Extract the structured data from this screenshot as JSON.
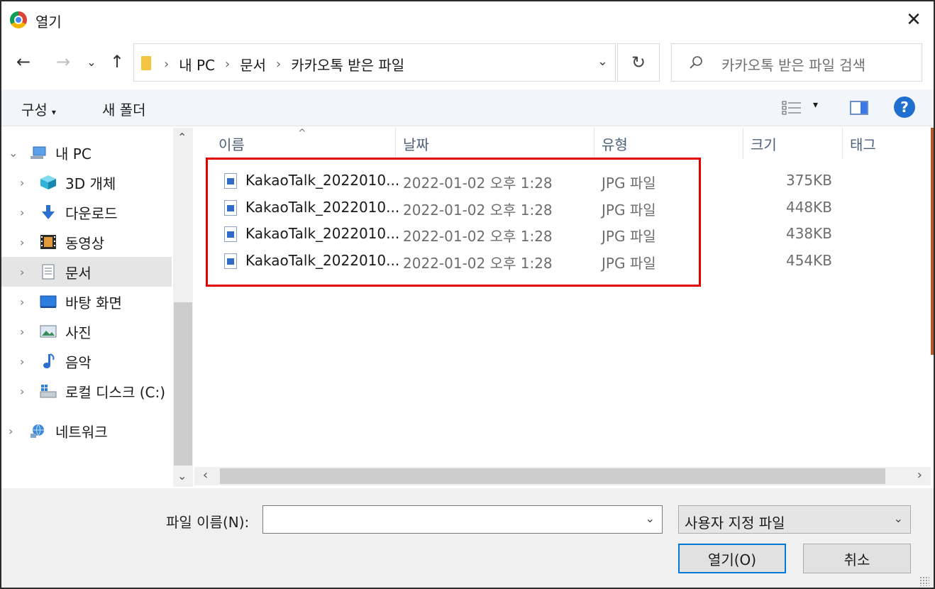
{
  "window": {
    "title": "열기",
    "close_glyph": "✕"
  },
  "nav": {
    "back_glyph": "←",
    "forward_glyph": "→",
    "recent_glyph": "⌄",
    "up_glyph": "↑",
    "breadcrumbs": [
      "내 PC",
      "문서",
      "카카오톡 받은 파일"
    ],
    "crumb_separator": "›",
    "address_dropdown_glyph": "⌄",
    "refresh_glyph": "↻",
    "search_placeholder": "카카오톡 받은 파일 검색"
  },
  "toolbar": {
    "organize_label": "구성",
    "organize_caret": "▾",
    "new_folder_label": "새 폴더",
    "view_caret": "▾",
    "help_glyph": "?"
  },
  "sidebar": {
    "items": [
      {
        "label": "내 PC",
        "expander": "⌄",
        "icon": "computer-icon"
      },
      {
        "label": "3D 개체",
        "expander": "›",
        "icon": "cube-3d-icon"
      },
      {
        "label": "다운로드",
        "expander": "›",
        "icon": "download-arrow-icon"
      },
      {
        "label": "동영상",
        "expander": "›",
        "icon": "film-icon"
      },
      {
        "label": "문서",
        "expander": "›",
        "icon": "document-icon"
      },
      {
        "label": "바탕 화면",
        "expander": "›",
        "icon": "desktop-icon"
      },
      {
        "label": "사진",
        "expander": "›",
        "icon": "picture-icon"
      },
      {
        "label": "음악",
        "expander": "›",
        "icon": "music-note-icon"
      },
      {
        "label": "로컬 디스크 (C:)",
        "expander": "›",
        "icon": "drive-icon"
      },
      {
        "label": "네트워크",
        "expander": "›",
        "icon": "network-icon"
      }
    ],
    "selected": "문서",
    "scroll_up_glyph": "⌃",
    "scroll_down_glyph": "⌄"
  },
  "filelist": {
    "columns": {
      "name": "이름",
      "date": "날짜",
      "type": "유형",
      "size": "크기",
      "tags": "태그"
    },
    "sort_glyph": "^",
    "files": [
      {
        "name": "KakaoTalk_2022010...",
        "date": "2022-01-02 오후 1:28",
        "type": "JPG 파일",
        "size": "375KB"
      },
      {
        "name": "KakaoTalk_2022010...",
        "date": "2022-01-02 오후 1:28",
        "type": "JPG 파일",
        "size": "448KB"
      },
      {
        "name": "KakaoTalk_2022010...",
        "date": "2022-01-02 오후 1:28",
        "type": "JPG 파일",
        "size": "438KB"
      },
      {
        "name": "KakaoTalk_2022010...",
        "date": "2022-01-02 오후 1:28",
        "type": "JPG 파일",
        "size": "454KB"
      }
    ],
    "scroll_left_glyph": "‹",
    "scroll_right_glyph": "›"
  },
  "bottom": {
    "filename_label": "파일 이름(N):",
    "filename_value": "",
    "filename_dropdown_glyph": "⌄",
    "filetype_value": "사용자 지정 파일",
    "filetype_dropdown_glyph": "⌄",
    "open_label": "열기(O)",
    "cancel_label": "취소"
  },
  "colors": {
    "highlight_border": "#e00000",
    "accent": "#0078d7",
    "selected_row": "#e5e5e5"
  }
}
